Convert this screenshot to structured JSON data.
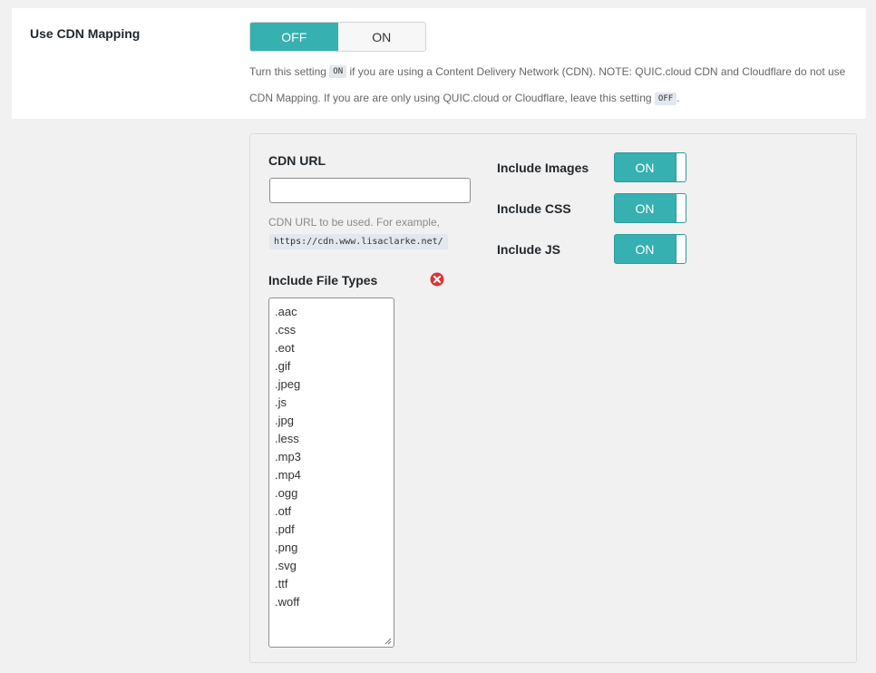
{
  "cdn_mapping": {
    "label": "Use CDN Mapping",
    "off_label": "OFF",
    "on_label": "ON",
    "selected": "OFF",
    "desc_part1": "Turn this setting",
    "desc_code_on": "ON",
    "desc_part2": "if you are using a Content Delivery Network (CDN). NOTE: QUIC.cloud CDN and Cloudflare do not use CDN Mapping. If you are are only using QUIC.cloud or Cloudflare, leave this setting",
    "desc_code_off": "OFF",
    "desc_part3": "."
  },
  "cdn_url": {
    "label": "CDN URL",
    "value": "",
    "hint": "CDN URL to be used. For example,",
    "example": "https://cdn.www.lisaclarke.net/"
  },
  "include_file_types": {
    "label": "Include File Types",
    "items": [
      ".aac",
      ".css",
      ".eot",
      ".gif",
      ".jpeg",
      ".js",
      ".jpg",
      ".less",
      ".mp3",
      ".mp4",
      ".ogg",
      ".otf",
      ".pdf",
      ".png",
      ".svg",
      ".ttf",
      ".woff"
    ]
  },
  "includes": [
    {
      "label": "Include Images",
      "state": "ON"
    },
    {
      "label": "Include CSS",
      "state": "ON"
    },
    {
      "label": "Include JS",
      "state": "ON"
    }
  ],
  "colors": {
    "accent": "#36b0b0",
    "remove_icon": "#dc3232"
  },
  "icons": {
    "remove": "remove-circle-icon"
  }
}
